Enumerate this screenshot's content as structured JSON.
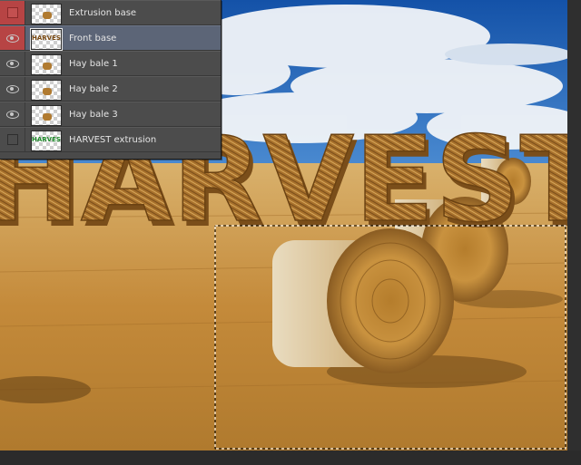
{
  "layers_panel": {
    "layers": [
      {
        "name": "Extrusion base",
        "visibility": "off",
        "highlighted": true,
        "selected": false,
        "thumbnail_icon": "bale-thumbnail"
      },
      {
        "name": "Front base",
        "visibility": "on",
        "highlighted": true,
        "selected": true,
        "thumbnail_icon": "harvest-text-thumbnail",
        "thumbnail_text": "HARVEST"
      },
      {
        "name": "Hay bale 1",
        "visibility": "on",
        "highlighted": false,
        "selected": false,
        "thumbnail_icon": "bale-thumbnail"
      },
      {
        "name": "Hay bale 2",
        "visibility": "on",
        "highlighted": false,
        "selected": false,
        "thumbnail_icon": "bale-thumbnail"
      },
      {
        "name": "Hay bale 3",
        "visibility": "on",
        "highlighted": false,
        "selected": false,
        "thumbnail_icon": "bale-thumbnail"
      },
      {
        "name": "HARVEST extrusion",
        "visibility": "off",
        "highlighted": false,
        "selected": false,
        "thumbnail_icon": "harvest-text-thumbnail",
        "thumbnail_text": "HARVEST"
      }
    ]
  },
  "canvas": {
    "headline_text": "HARVEST",
    "colors": {
      "sky": "#1f5fb8",
      "cloud": "#eef2f6",
      "field": "#c8913e",
      "straw_letters": "#9a6a2a",
      "selected_row": "#5c6577",
      "visibility_highlight": "#b74444"
    },
    "marquee_selection": true
  }
}
